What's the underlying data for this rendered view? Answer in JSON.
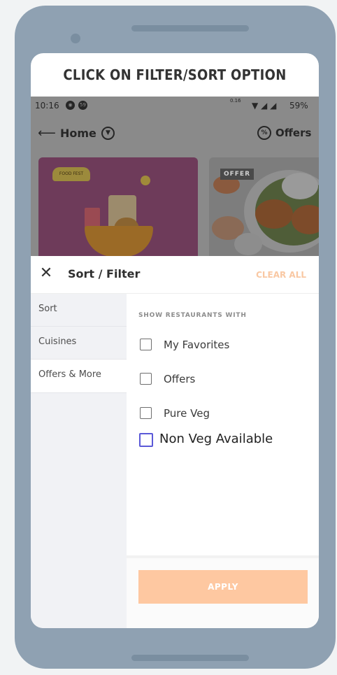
{
  "caption": "CLICK ON FILTER/SORT OPTION",
  "status_bar": {
    "time": "10:16",
    "net_speed": "0.16",
    "battery": "59%"
  },
  "app_bar": {
    "back_icon": "arrow-left",
    "title": "Home",
    "dropdown_icon": "chevron-down-circle",
    "offers_icon": "percent-badge",
    "offers_label": "Offers"
  },
  "banners": {
    "second_tag": "OFFER"
  },
  "filter_sheet": {
    "close_icon": "close-x",
    "title": "Sort / Filter",
    "clear_all": "CLEAR ALL",
    "sidebar": [
      {
        "label": "Sort"
      },
      {
        "label": "Cuisines"
      },
      {
        "label": "Offers & More"
      }
    ],
    "section_label": "SHOW RESTAURANTS WITH",
    "options": [
      {
        "label": "My Favorites",
        "checked": false
      },
      {
        "label": "Offers",
        "checked": false
      },
      {
        "label": "Pure Veg",
        "checked": false
      },
      {
        "label": "Non Veg Available",
        "checked": false
      }
    ],
    "apply_label": "APPLY"
  },
  "colors": {
    "accent": "#fec8a1",
    "clear_all": "#f9c8a3",
    "highlight_checkbox": "#5b59d8",
    "device_frame": "#8fa1b2"
  }
}
